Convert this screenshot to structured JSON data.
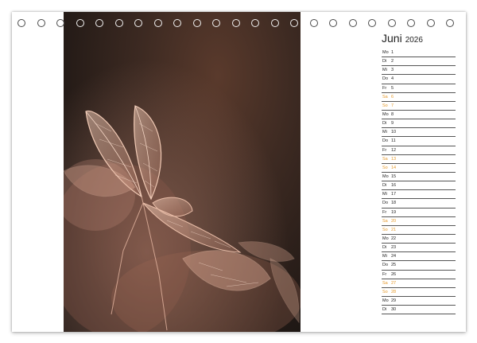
{
  "calendar": {
    "month": "Juni",
    "year": "2026",
    "weekend_color": "#e59a2c",
    "days": [
      {
        "wd": "Mo",
        "dn": "1",
        "weekend": false
      },
      {
        "wd": "Di",
        "dn": "2",
        "weekend": false
      },
      {
        "wd": "Mi",
        "dn": "3",
        "weekend": false
      },
      {
        "wd": "Do",
        "dn": "4",
        "weekend": false
      },
      {
        "wd": "Fr",
        "dn": "5",
        "weekend": false
      },
      {
        "wd": "Sa",
        "dn": "6",
        "weekend": true
      },
      {
        "wd": "So",
        "dn": "7",
        "weekend": true
      },
      {
        "wd": "Mo",
        "dn": "8",
        "weekend": false
      },
      {
        "wd": "Di",
        "dn": "9",
        "weekend": false
      },
      {
        "wd": "Mi",
        "dn": "10",
        "weekend": false
      },
      {
        "wd": "Do",
        "dn": "11",
        "weekend": false
      },
      {
        "wd": "Fr",
        "dn": "12",
        "weekend": false
      },
      {
        "wd": "Sa",
        "dn": "13",
        "weekend": true
      },
      {
        "wd": "So",
        "dn": "14",
        "weekend": true
      },
      {
        "wd": "Mo",
        "dn": "15",
        "weekend": false
      },
      {
        "wd": "Di",
        "dn": "16",
        "weekend": false
      },
      {
        "wd": "Mi",
        "dn": "17",
        "weekend": false
      },
      {
        "wd": "Do",
        "dn": "18",
        "weekend": false
      },
      {
        "wd": "Fr",
        "dn": "19",
        "weekend": false
      },
      {
        "wd": "Sa",
        "dn": "20",
        "weekend": true
      },
      {
        "wd": "So",
        "dn": "21",
        "weekend": true
      },
      {
        "wd": "Mo",
        "dn": "22",
        "weekend": false
      },
      {
        "wd": "Di",
        "dn": "23",
        "weekend": false
      },
      {
        "wd": "Mi",
        "dn": "24",
        "weekend": false
      },
      {
        "wd": "Do",
        "dn": "25",
        "weekend": false
      },
      {
        "wd": "Fr",
        "dn": "26",
        "weekend": false
      },
      {
        "wd": "Sa",
        "dn": "27",
        "weekend": true
      },
      {
        "wd": "So",
        "dn": "28",
        "weekend": true
      },
      {
        "wd": "Mo",
        "dn": "29",
        "weekend": false
      },
      {
        "wd": "Di",
        "dn": "30",
        "weekend": false
      }
    ]
  },
  "photo": {
    "subject": "dried-hydrangea-skeleton-leaves",
    "background_color": "#2a1f1a",
    "leaf_color": "#e8b9a4"
  },
  "binding": {
    "hole_count": 23
  }
}
